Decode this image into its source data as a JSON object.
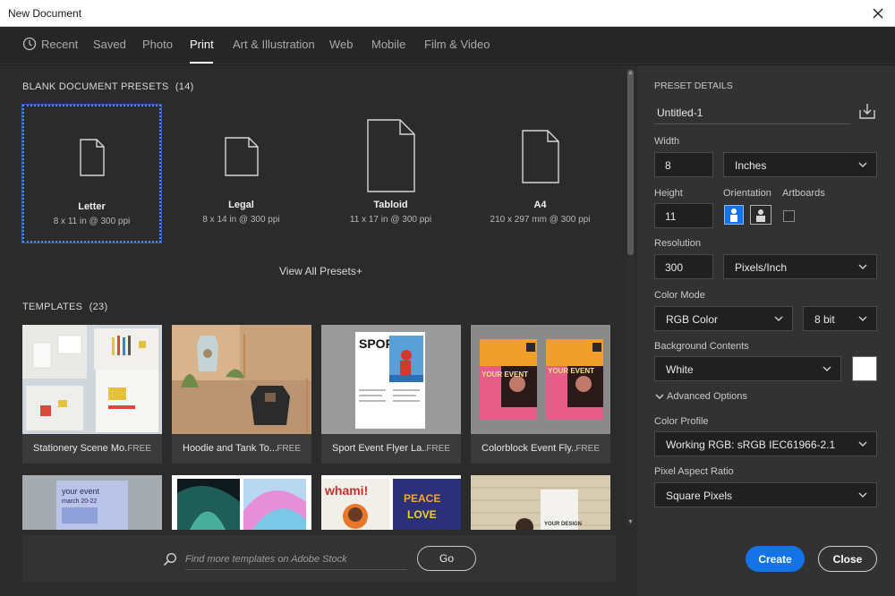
{
  "window": {
    "title": "New Document"
  },
  "tabs": [
    {
      "label": "Recent",
      "icon": "clock-icon"
    },
    {
      "label": "Saved"
    },
    {
      "label": "Photo"
    },
    {
      "label": "Print",
      "active": true
    },
    {
      "label": "Art & Illustration"
    },
    {
      "label": "Web"
    },
    {
      "label": "Mobile"
    },
    {
      "label": "Film & Video"
    }
  ],
  "presets": {
    "title": "BLANK DOCUMENT PRESETS",
    "count": "(14)",
    "items": [
      {
        "name": "Letter",
        "desc": "8 x 11 in @ 300 ppi",
        "selected": true
      },
      {
        "name": "Legal",
        "desc": "8 x 14 in @ 300 ppi"
      },
      {
        "name": "Tabloid",
        "desc": "11 x 17 in @ 300 ppi"
      },
      {
        "name": "A4",
        "desc": "210 x 297 mm @ 300 ppi"
      }
    ],
    "view_all": "View All Presets+"
  },
  "templates": {
    "title": "TEMPLATES",
    "count": "(23)",
    "items": [
      {
        "label": "Stationery Scene Mo...",
        "badge": "FREE"
      },
      {
        "label": "Hoodie and Tank To...",
        "badge": "FREE"
      },
      {
        "label": "Sport Event Flyer La...",
        "badge": "FREE"
      },
      {
        "label": "Colorblock Event Fly...",
        "badge": "FREE"
      }
    ],
    "row2_text": {
      "event_title": "your event",
      "event_date": "march 20-22",
      "whami": "whami!",
      "peace": "PEACE",
      "love": "LOVE",
      "your_design": "YOUR DESIGN"
    },
    "thumb_text": {
      "sport": "SPORT",
      "your_event": "YOUR EVENT",
      "event_date": "22 MAR 2022"
    }
  },
  "search": {
    "placeholder": "Find more templates on Adobe Stock",
    "go_label": "Go"
  },
  "details": {
    "title": "PRESET DETAILS",
    "doc_name": "Untitled-1",
    "width_label": "Width",
    "width_value": "8",
    "width_unit": "Inches",
    "height_label": "Height",
    "height_value": "11",
    "orientation_label": "Orientation",
    "artboards_label": "Artboards",
    "resolution_label": "Resolution",
    "resolution_value": "300",
    "resolution_unit": "Pixels/Inch",
    "color_mode_label": "Color Mode",
    "color_mode": "RGB Color",
    "bit_depth": "8 bit",
    "background_label": "Background Contents",
    "background": "White",
    "advanced_label": "Advanced Options",
    "color_profile_label": "Color Profile",
    "color_profile": "Working RGB: sRGB IEC61966-2.1",
    "pixel_aspect_label": "Pixel Aspect Ratio",
    "pixel_aspect": "Square Pixels"
  },
  "actions": {
    "create": "Create",
    "close": "Close"
  },
  "colors": {
    "accent": "#1473e6",
    "selection": "#4f8df2",
    "panel": "#2b2b2b",
    "side_panel": "#323232"
  }
}
